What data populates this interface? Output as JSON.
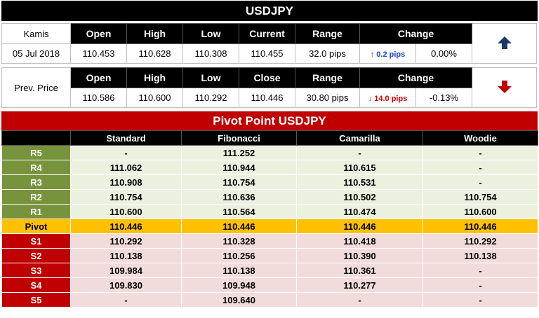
{
  "title": "USDJPY",
  "current": {
    "label_day": "Kamis",
    "label_date": "05 Jul 2018",
    "headers": [
      "Open",
      "High",
      "Low",
      "Current",
      "Range",
      "Change"
    ],
    "open": "110.453",
    "high": "110.628",
    "low": "110.308",
    "current": "110.455",
    "range": "32.0 pips",
    "change_pips": "↑ 0.2 pips",
    "change_pct": "0.00%",
    "direction_icon": "arrow-up-icon",
    "arrow_color": "#1f3864"
  },
  "previous": {
    "label": "Prev. Price",
    "headers": [
      "Open",
      "High",
      "Low",
      "Close",
      "Range",
      "Change"
    ],
    "open": "110.586",
    "high": "110.600",
    "low": "110.292",
    "close": "110.446",
    "range": "30.80 pips",
    "change_pips": "↓ 14.0 pips",
    "change_pct": "-0.13%",
    "direction_icon": "arrow-down-icon",
    "arrow_color": "#c00000"
  },
  "pivot": {
    "title": "Pivot Point USDJPY",
    "columns": [
      "Standard",
      "Fibonacci",
      "Camarilla",
      "Woodie"
    ],
    "rows": [
      {
        "label": "R5",
        "kind": "res",
        "values": [
          "-",
          "111.252",
          "-",
          "-"
        ]
      },
      {
        "label": "R4",
        "kind": "res",
        "values": [
          "111.062",
          "110.944",
          "110.615",
          "-"
        ]
      },
      {
        "label": "R3",
        "kind": "res",
        "values": [
          "110.908",
          "110.754",
          "110.531",
          "-"
        ]
      },
      {
        "label": "R2",
        "kind": "res",
        "values": [
          "110.754",
          "110.636",
          "110.502",
          "110.754"
        ]
      },
      {
        "label": "R1",
        "kind": "res",
        "values": [
          "110.600",
          "110.564",
          "110.474",
          "110.600"
        ]
      },
      {
        "label": "Pivot",
        "kind": "piv",
        "values": [
          "110.446",
          "110.446",
          "110.446",
          "110.446"
        ]
      },
      {
        "label": "S1",
        "kind": "sup",
        "values": [
          "110.292",
          "110.328",
          "110.418",
          "110.292"
        ]
      },
      {
        "label": "S2",
        "kind": "sup",
        "values": [
          "110.138",
          "110.256",
          "110.390",
          "110.138"
        ]
      },
      {
        "label": "S3",
        "kind": "sup",
        "values": [
          "109.984",
          "110.138",
          "110.361",
          "-"
        ]
      },
      {
        "label": "S4",
        "kind": "sup",
        "values": [
          "109.830",
          "109.948",
          "110.277",
          "-"
        ]
      },
      {
        "label": "S5",
        "kind": "sup",
        "values": [
          "-",
          "109.640",
          "-",
          "-"
        ]
      }
    ]
  },
  "colors": {
    "resistance_label": "#77933c",
    "resistance_row": "#ebf1de",
    "pivot_row": "#ffc000",
    "support_label": "#c00000",
    "support_row": "#f2dcdb",
    "header_black": "#000000",
    "pivot_title": "#c00000"
  }
}
